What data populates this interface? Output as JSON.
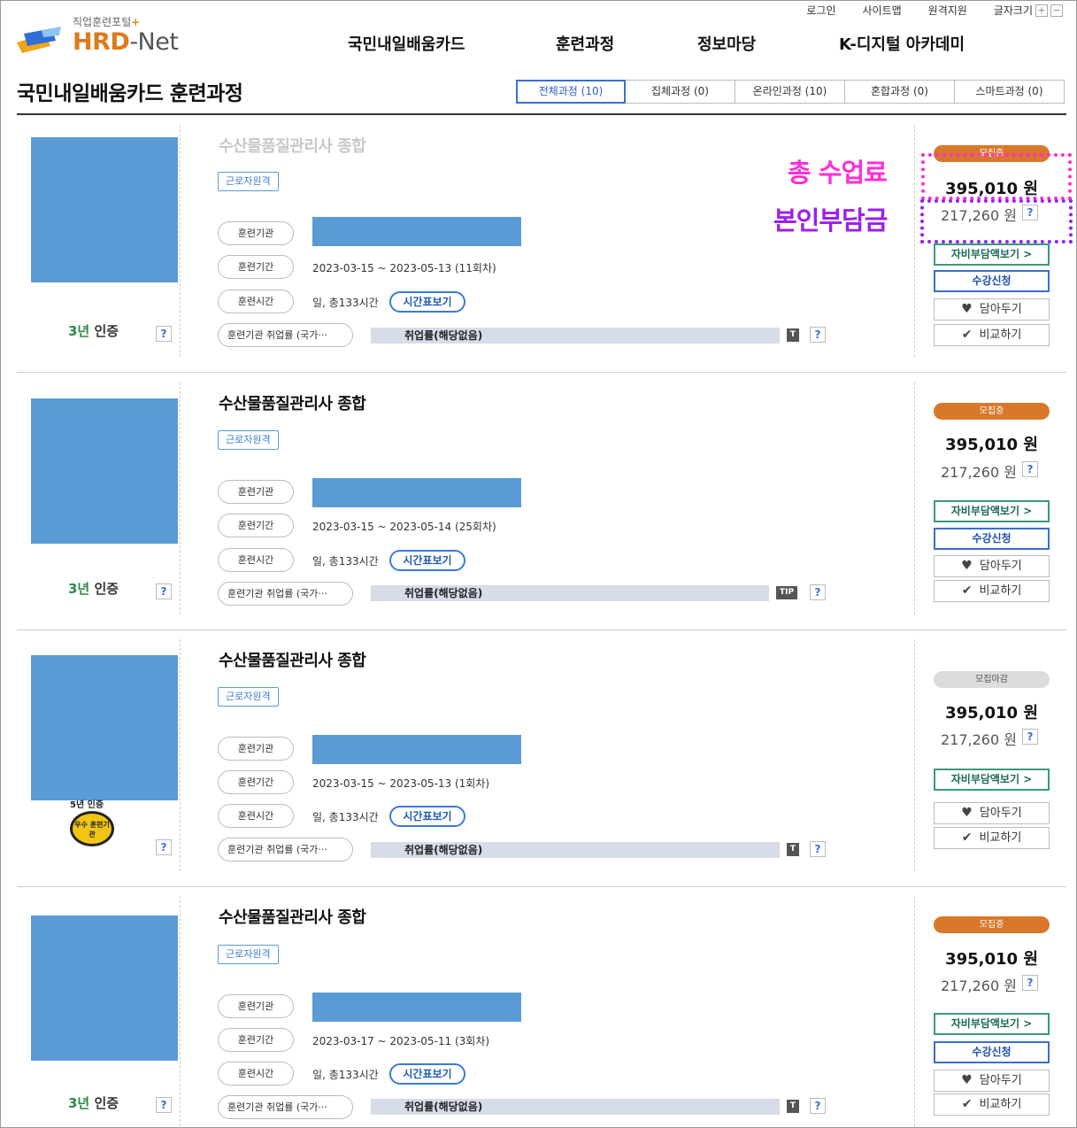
{
  "header": {
    "util": [
      "로그인",
      "사이트맵",
      "원격지원",
      "글자크기"
    ],
    "logo_tag": "직업훈련포털",
    "logo_name_a": "HRD",
    "logo_name_b": "-Net",
    "nav": [
      "국민내일배움카드",
      "훈련과정",
      "정보마당",
      "K-디지털 아카데미"
    ]
  },
  "page_title": "국민내일배움카드 훈련과정",
  "tabs": [
    "전체과정 (10)",
    "집체과정 (0)",
    "온라인과정 (10)",
    "혼합과정 (0)",
    "스마트과정 (0)"
  ],
  "annotations": {
    "total_fee": "총 수업료",
    "self_pay": "본인부담금"
  },
  "labels": {
    "tag": "근로자원격",
    "institution": "훈련기관",
    "period": "훈련기간",
    "hours": "훈련시간",
    "employment": "훈련기관 취업률 (국가···",
    "hours_value": "일, 총133시간",
    "timetable": "시간표보기",
    "emp_value": "취업률(해당없음)",
    "self_pay_btn": "자비부담액보기 >",
    "apply_btn": "수강신청",
    "wish_btn": "담아두기",
    "compare_btn": "비교하기",
    "q": "?",
    "cert": "인증",
    "cert_num": "3년"
  },
  "courses": [
    {
      "title": "수산물품질관리사 종합",
      "period": "2023-03-15 ~ 2023-05-13 (11회차)",
      "status": "모집중",
      "price": "395,010 원",
      "self_price": "217,260 원",
      "tico": "T"
    },
    {
      "title": "수산물품질관리사 종합",
      "period": "2023-03-15 ~ 2023-05-14 (25회차)",
      "status": "모집중",
      "price": "395,010 원",
      "self_price": "217,260 원",
      "tico": "TIP"
    },
    {
      "title": "수산물품질관리사 종합",
      "period": "2023-03-15 ~ 2023-05-13 (1회차)",
      "status": "모집마감",
      "price": "395,010 원",
      "self_price": "217,260 원",
      "tico": "T",
      "cert5": "5년 인증",
      "badge": "우수 훈련기관"
    },
    {
      "title": "수산물품질관리사 종합",
      "period": "2023-03-17 ~ 2023-05-11 (3회차)",
      "status": "모집중",
      "price": "395,010 원",
      "self_price": "217,260 원",
      "tico": "T"
    }
  ],
  "colors": {
    "accent": "#3a6fcf",
    "status_open": "#d9782a",
    "annotation_pink": "#ff2ed6",
    "annotation_purple": "#9b1ff0"
  }
}
